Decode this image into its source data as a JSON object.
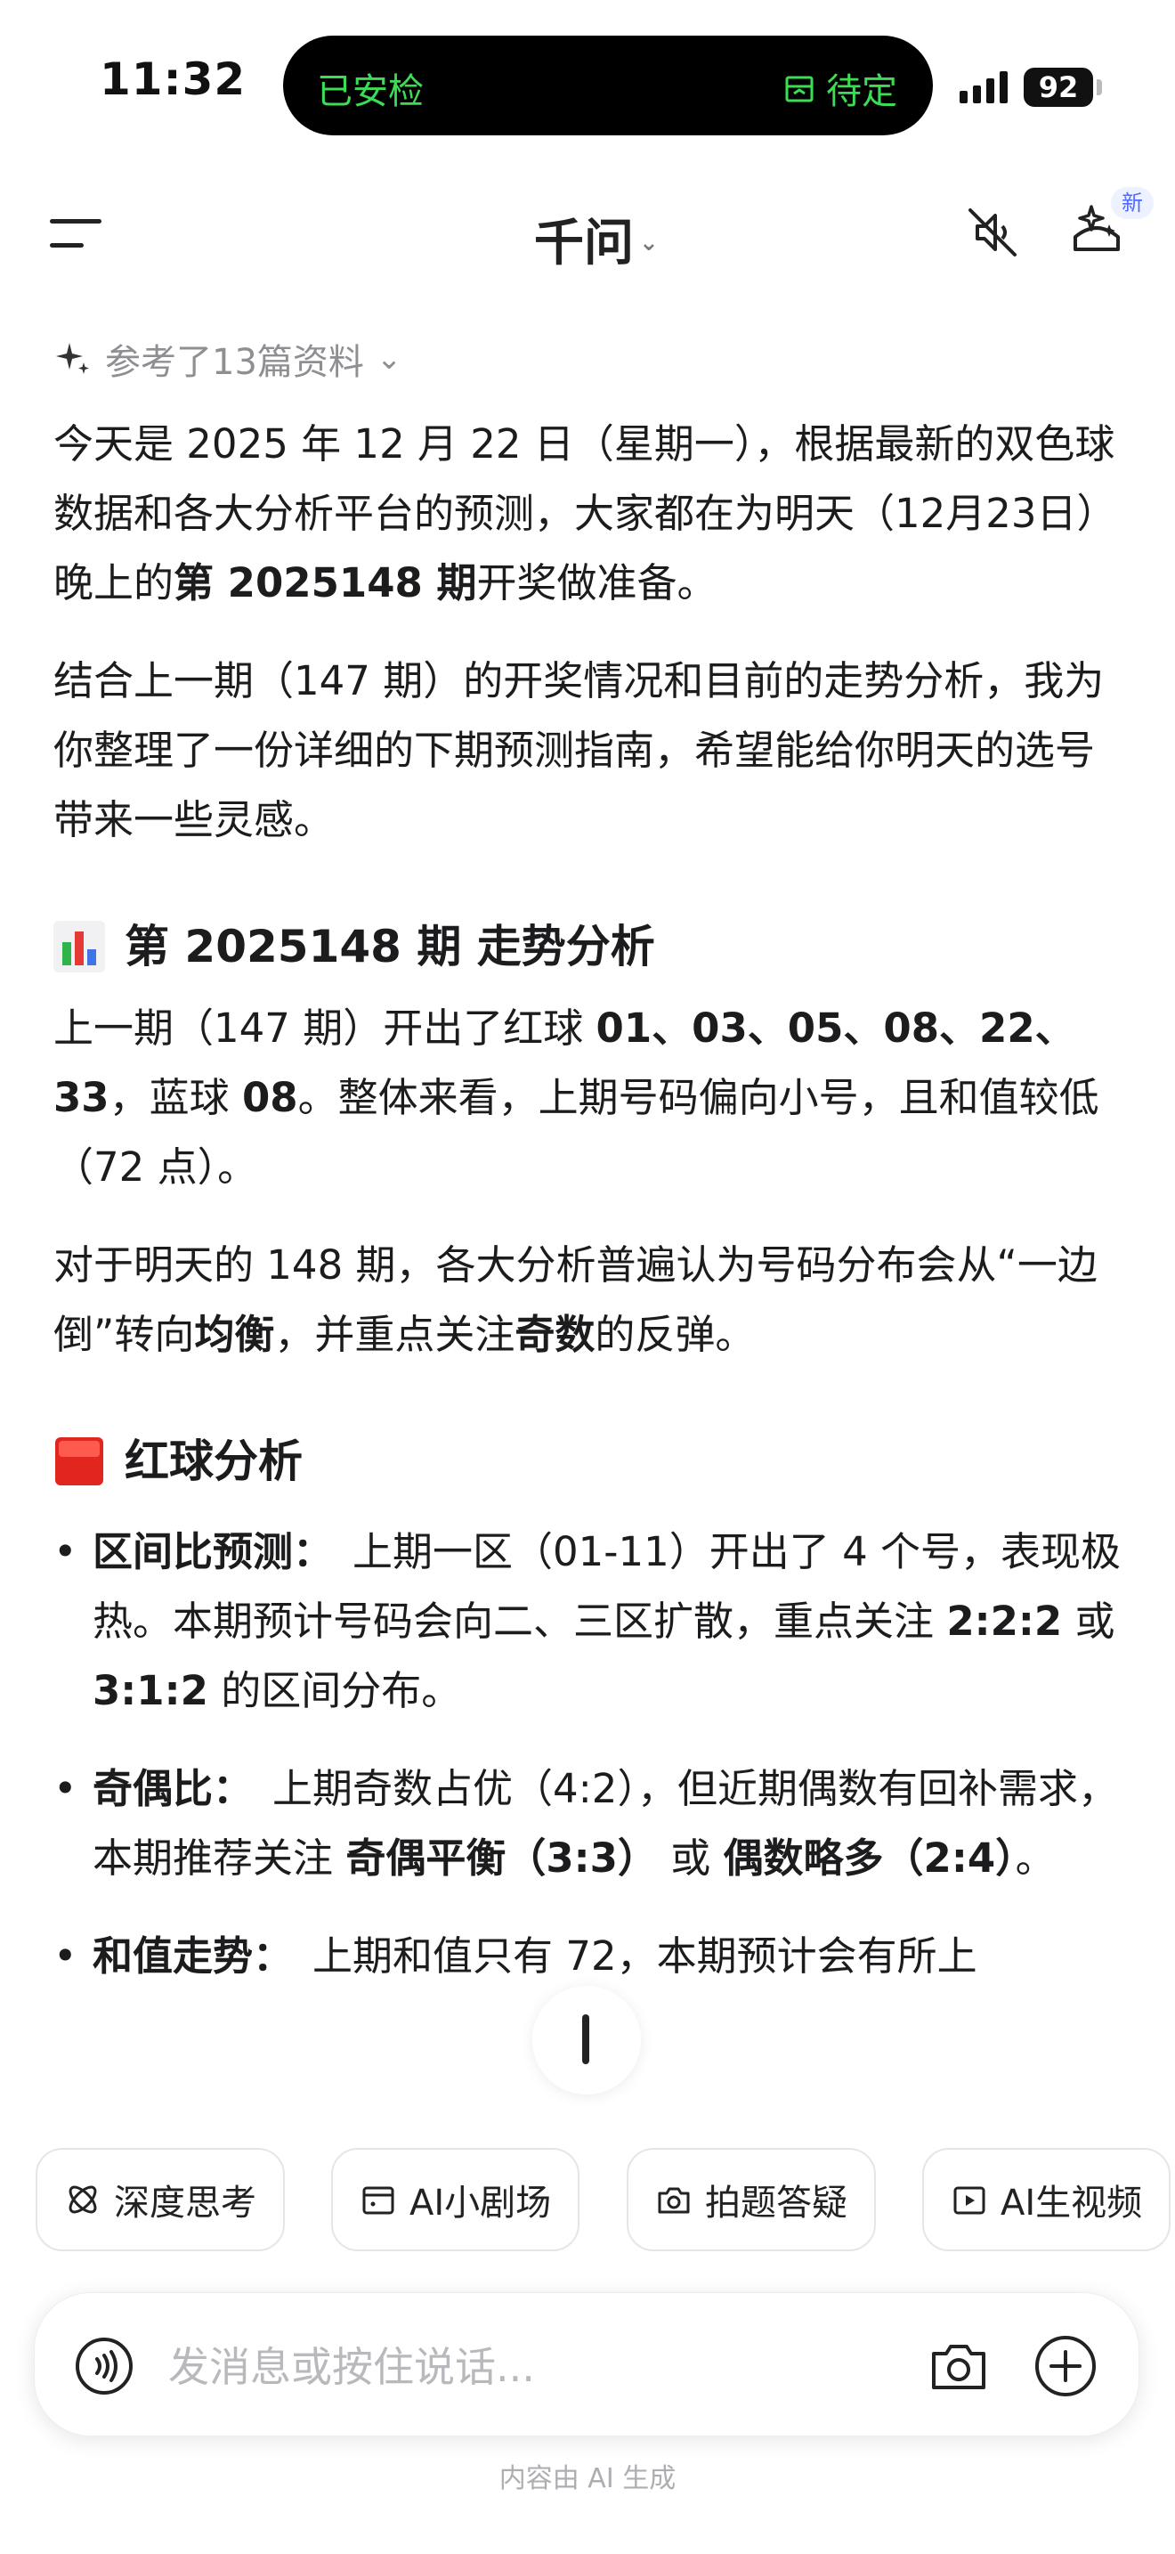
{
  "status_bar": {
    "time": "11:32",
    "island_left": "已安检",
    "island_right": "待定",
    "battery": "92"
  },
  "header": {
    "title": "千问",
    "badge": "新"
  },
  "references": {
    "label": "参考了13篇资料"
  },
  "content": {
    "p1_a": "今天是 2025 年 12 月 22 日（星期一），根据最新的双色球数据和各大分析平台的预测，大家都在为明天（12月23日）晚上的",
    "p1_b": "第 2025148 期",
    "p1_c": "开奖做准备。",
    "p2": "结合上一期（147 期）的开奖情况和目前的走势分析，我为你整理了一份详细的下期预测指南，希望能给你明天的选号带来一些灵感。",
    "section1_title": "第 2025148 期 走势分析",
    "p3_a": "上一期（147 期）开出了红球 ",
    "p3_b": "01、03、05、08、22、33",
    "p3_c": "，蓝球 ",
    "p3_d": "08",
    "p3_e": "。整体来看，上期号码偏向小号，且和值较低（72 点）。",
    "p4_a": "对于明天的 148 期，各大分析普遍认为号码分布会从“一边倒”转向",
    "p4_b": "均衡",
    "p4_c": "，并重点关注",
    "p4_d": "奇数",
    "p4_e": "的反弹。",
    "section2_title": "红球分析",
    "bullets": {
      "b1_title": "区间比预测：",
      "b1_a": "上期一区（01-11）开出了 4 个号，表现极热。本期预计号码会向二、三区扩散，重点关注 ",
      "b1_b": "2:2:2",
      "b1_c": " 或 ",
      "b1_d": "3:1:2",
      "b1_e": " 的区间分布。",
      "b2_title": "奇偶比：",
      "b2_a": "上期奇数占优（4:2），但近期偶数有回补需求，本期推荐关注 ",
      "b2_b": "奇偶平衡（3:3）",
      "b2_c": " 或 ",
      "b2_d": "偶数略多（2:4）",
      "b2_e": "。",
      "b3_title": "和值走势：",
      "b3_a": "上期和值只有 72，本期预计会有所上"
    }
  },
  "chips": [
    "深度思考",
    "AI小剧场",
    "拍题答疑",
    "AI生视频"
  ],
  "input": {
    "placeholder": "发消息或按住说话..."
  },
  "footer": {
    "note": "内容由 AI 生成"
  },
  "colors": {
    "island_green": "#3ddc55",
    "badge_blue": "#4f6bff",
    "bar_green": "#2fb34a",
    "bar_red": "#e53935",
    "bar_blue": "#3f73e6"
  }
}
